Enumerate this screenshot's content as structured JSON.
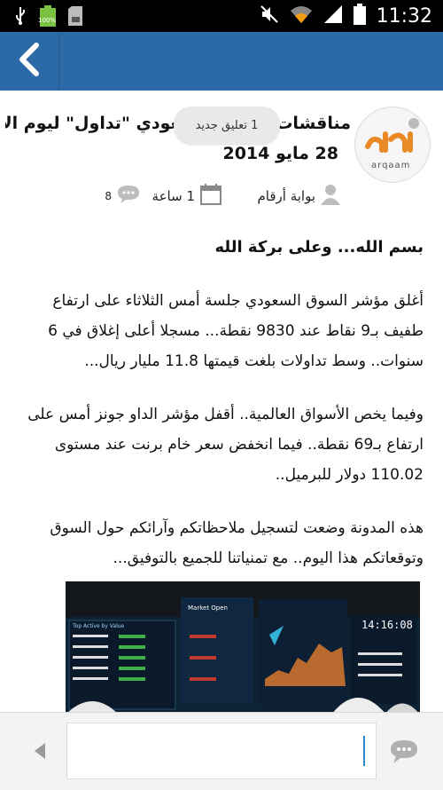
{
  "status_bar": {
    "time": "11:32",
    "battery_label": "100%"
  },
  "article": {
    "title_line1": "مناقشات السوق السعودي \"تداول\" ليوم الأربعاء",
    "title_line2": "28 مايو 2014",
    "toast": "1 تعليق جديد",
    "author": "بوابة أرقام",
    "time_ago": "1 ساعة",
    "comment_count": "8",
    "logo_text": "arqaam",
    "paragraphs": [
      "بسم الله... وعلى بركة الله",
      "أغلق مؤشر السوق السعودي جلسة أمس الثلاثاء على ارتفاع طفيف بـ9 نقاط عند 9830 نقطة... مسجلا أعلى إغلاق في 6 سنوات.. وسط تداولات بلغت قيمتها 11.8 مليار ريال...",
      "وفيما يخص الأسواق العالمية.. أقفل مؤشر الداو جونز أمس على ارتفاع بـ69 نقطة.. فيما انخفض سعر خام برنت عند مستوى 110.02 دولار للبرميل..",
      "هذه المدونة وضعت لتسجيل ملاحظاتكم وآرائكم حول السوق وتوقعاتكم هذا اليوم.. مع تمنياتنا للجميع بالتوفيق..."
    ]
  },
  "photo": {
    "board_top": "Market Open",
    "board_left": "Top Active by Value",
    "clock": "14:16:08"
  },
  "colors": {
    "action_bar": "#2b6aa6",
    "status_bar": "#000000",
    "accent": "#2f86c9"
  }
}
